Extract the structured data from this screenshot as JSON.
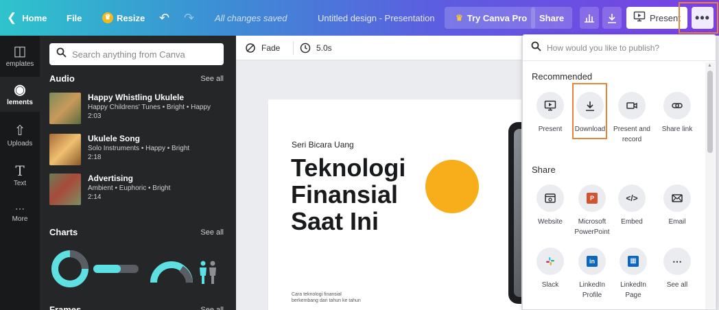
{
  "topbar": {
    "home": "Home",
    "file": "File",
    "resize": "Resize",
    "saved": "All changes saved",
    "title": "Untitled design - Presentation",
    "try_pro": "Try Canva Pro",
    "share": "Share",
    "present": "Present",
    "more": "•••"
  },
  "rail": {
    "templates": "emplates",
    "elements": "lements",
    "uploads": "Uploads",
    "text": "Text",
    "more": "More"
  },
  "panel": {
    "search_placeholder": "Search anything from Canva",
    "audio_heading": "Audio",
    "see_all": "See all",
    "audio": [
      {
        "title": "Happy Whistling Ukulele",
        "meta": "Happy Childrens' Tunes • Bright • Happy",
        "duration": "2:03"
      },
      {
        "title": "Ukulele Song",
        "meta": "Solo Instruments • Happy • Bright",
        "duration": "2:18"
      },
      {
        "title": "Advertising",
        "meta": "Ambient • Euphoric • Bright",
        "duration": "2:14"
      }
    ],
    "charts_heading": "Charts",
    "frames_heading": "Frames"
  },
  "editor": {
    "transition": "Fade",
    "duration": "5.0s",
    "slide": {
      "subtitle": "Seri Bicara Uang",
      "title_lines": [
        "Teknologi",
        "Finansial",
        "Saat Ini"
      ],
      "footer_lines": [
        "Cara teknologi finansial",
        "berkembang dari tahun ke tahun"
      ]
    }
  },
  "publish": {
    "search_placeholder": "How would you like to publish?",
    "recommended_heading": "Recommended",
    "recommended": [
      {
        "label": "Present",
        "icon": "present-icon"
      },
      {
        "label": "Download",
        "icon": "download-icon"
      },
      {
        "label": "Present and record",
        "icon": "record-icon"
      },
      {
        "label": "Share link",
        "icon": "link-icon"
      }
    ],
    "share_heading": "Share",
    "share": [
      {
        "label": "Website",
        "icon": "website-icon"
      },
      {
        "label": "Microsoft PowerPoint",
        "icon": "powerpoint-icon"
      },
      {
        "label": "Embed",
        "icon": "embed-icon"
      },
      {
        "label": "Email",
        "icon": "email-icon"
      },
      {
        "label": "Slack",
        "icon": "slack-icon"
      },
      {
        "label": "LinkedIn Profile",
        "icon": "linkedin-icon"
      },
      {
        "label": "LinkedIn Page",
        "icon": "linkedin-page-icon"
      },
      {
        "label": "See all",
        "icon": "more-icon"
      }
    ]
  },
  "colors": {
    "accent_orange": "#e8833a",
    "slide_circle": "#f7ae1a",
    "chart_teal": "#5ee0e3",
    "panel_bg": "#252627"
  }
}
